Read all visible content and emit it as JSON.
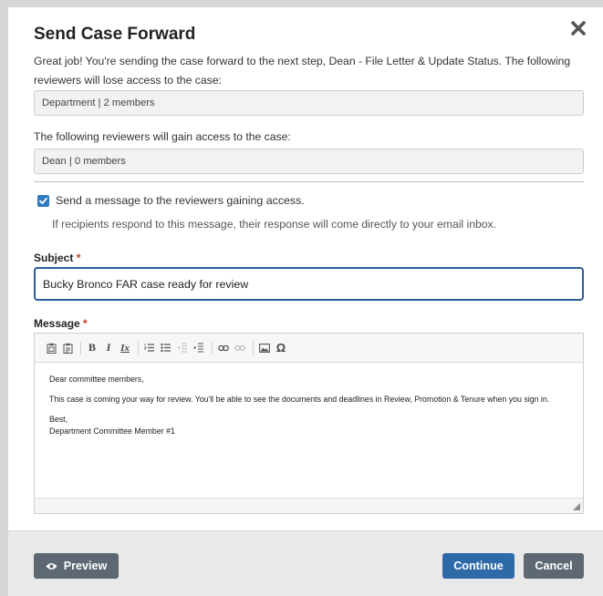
{
  "dialog": {
    "title": "Send Case Forward",
    "intro": "Great job! You're sending the case forward to the next step, Dean - File Letter & Update Status. The following reviewers will lose access to the case:",
    "losing_group": "Department | 2 members",
    "gain_label": "The following reviewers will gain access to the case:",
    "gaining_group": "Dean | 0 members",
    "send_message_checked": true,
    "send_message_label": "Send a message to the reviewers gaining access.",
    "hint": "If recipients respond to this message, their response will come directly to your email inbox.",
    "subject_label": "Subject",
    "subject_value": "Bucky Bronco FAR case ready for review",
    "message_label": "Message",
    "required_mark": "*",
    "message": {
      "greeting": "Dear committee members,",
      "body": "This case is coming your way for review. You'll be able to see the documents and deadlines in Review, Promotion & Tenure when you sign in.",
      "closing": "Best,",
      "signature": "Department Committee Member #1"
    },
    "toolbar": [
      "paste-icon",
      "paste-text-icon",
      "bold-icon",
      "italic-icon",
      "remove-format-icon",
      "numbered-list-icon",
      "bulleted-list-icon",
      "outdent-icon",
      "indent-icon",
      "link-icon",
      "unlink-icon",
      "image-icon",
      "special-char-icon"
    ],
    "toolbar_glyphs": {
      "bold": "B",
      "italic": "I",
      "remove_format": "Ix",
      "special_char": "Ω"
    }
  },
  "footer": {
    "preview_label": "Preview",
    "continue_label": "Continue",
    "cancel_label": "Cancel"
  },
  "colors": {
    "primary": "#2f6aa8",
    "secondary": "#5d6873",
    "checkbox": "#2f7bc2",
    "required": "#c0392b"
  }
}
